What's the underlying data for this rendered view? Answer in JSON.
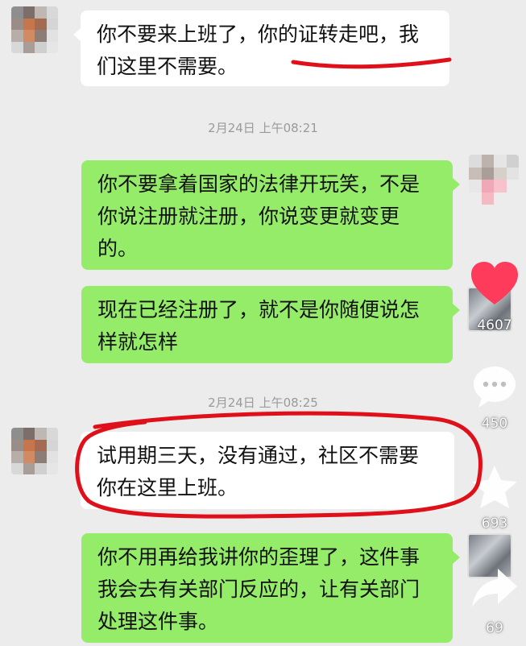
{
  "messages": [
    {
      "side": "in",
      "text": "你不要来上班了，你的证转走吧，我们这里不需要。"
    },
    {
      "side": "out",
      "text": "你不要拿着国家的法律开玩笑，不是你说注册就注册，你说变更就变更的。"
    },
    {
      "side": "out",
      "text": "现在已经注册了，就不是你随便说怎样就怎样"
    },
    {
      "side": "in",
      "text": "试用期三天，没有通过，社区不需要你在这里上班。"
    },
    {
      "side": "out",
      "text": "你不用再给我讲你的歪理了，这件事我会去有关部门反应的，让有关部门处理这件事。"
    }
  ],
  "timestamps": [
    "2月24日 上午08:21",
    "2月24日 上午08:25"
  ],
  "actions": {
    "like_count": "4607",
    "comment_count": "450",
    "favorite_count": "693",
    "share_count": "69"
  },
  "icons": {
    "like": "heart-icon",
    "comment": "comment-bubble-icon",
    "favorite": "star-icon",
    "share": "share-arrow-icon"
  },
  "colors": {
    "incoming_bubble": "#ffffff",
    "outgoing_bubble": "#95ec69",
    "background": "#ececec",
    "like_heart": "#ff3b5c",
    "annotation_red": "#e0101a"
  }
}
